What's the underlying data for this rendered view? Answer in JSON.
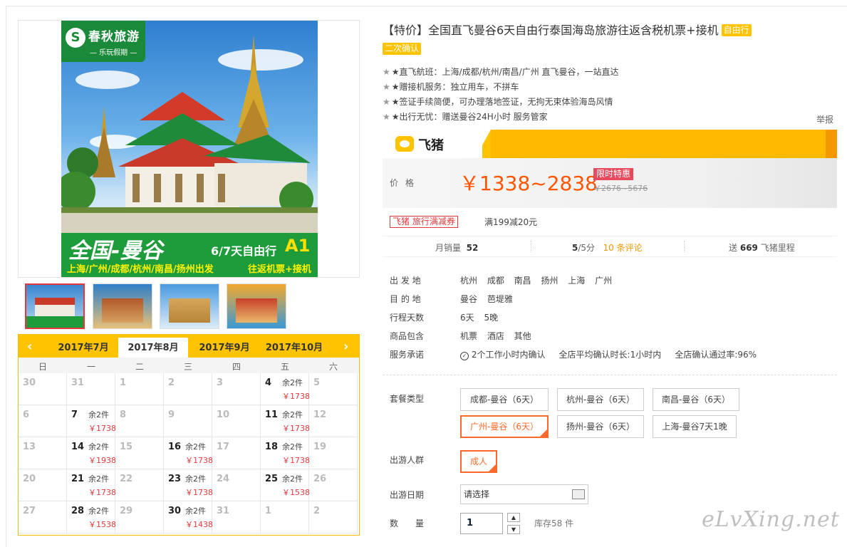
{
  "product": {
    "title": "【特价】全国直飞曼谷6天自由行泰国海岛旅游往返含税机票+接机",
    "tag_free": "自由行",
    "tag_confirm": "二次确认",
    "features": [
      "★直飞航班：上海/成都/杭州/南昌/广州 直飞曼谷，一站直达",
      "★赠接机服务：独立用车，不拼车",
      "★签证手续简便，可办理落地签证，无拘无束体验海岛风情",
      "★出行无忧：赠送曼谷24H小时 服务管家"
    ],
    "report": "举报",
    "brand": "飞猪",
    "price_label": "价格",
    "price": "￥1338~2838",
    "promo": "限时特惠",
    "price_old": "￥2676~5676",
    "coupon_badge": "飞猪 旅行满减券",
    "coupon_text": "满199减20元",
    "stats": {
      "monthly_label": "月销量",
      "monthly_value": "52",
      "rating_value": "5",
      "rating_suffix": "/5分",
      "reviews": "10 条评论",
      "miles_prefix": "送",
      "miles_value": "669",
      "miles_suffix": "飞猪里程"
    },
    "info": [
      {
        "label": "出 发 地",
        "value": "杭州  成都  南昌  扬州  上海  广州"
      },
      {
        "label": "目 的 地",
        "value": "曼谷  芭堤雅"
      },
      {
        "label": "行程天数",
        "value": "6天  5晚"
      },
      {
        "label": "商品包含",
        "value": "机票  酒店  其他"
      }
    ],
    "service_label": "服务承诺",
    "service_items": [
      "2个工作小时内确认",
      "全店平均确认时长:1小时内",
      "全店确认通过率:96%"
    ],
    "package_label": "套餐类型",
    "packages": [
      "成都-曼谷（6天）",
      "杭州-曼谷（6天）",
      "南昌-曼谷（6天）",
      "广州-曼谷（6天）",
      "扬州-曼谷（6天）",
      "上海-曼谷7天1晚"
    ],
    "crowd_label": "出游人群",
    "crowd_option": "成人",
    "date_label": "出游日期",
    "date_placeholder": "请选择",
    "qty_label": "数　　量",
    "qty_value": "1",
    "stock": "库存58 件",
    "watermark": "eLvXing.net"
  },
  "hero": {
    "logo_name": "春秋旅游",
    "logo_sub": "— 乐玩假期 —",
    "banner_title": "全国-曼谷",
    "banner_days": "6/7天自由行",
    "banner_code": "A1",
    "banner_cities": "上海/广州/成都/杭州/南昌/扬州出发",
    "banner_ticket": "往返机票+接机"
  },
  "calendar": {
    "months": [
      "2017年7月",
      "2017年8月",
      "2017年9月",
      "2017年10月"
    ],
    "active_month": 1,
    "weekdays": [
      "日",
      "一",
      "二",
      "三",
      "四",
      "五",
      "六"
    ],
    "weeks": [
      [
        {
          "d": "30"
        },
        {
          "d": "31"
        },
        {
          "d": "1"
        },
        {
          "d": "2"
        },
        {
          "d": "3"
        },
        {
          "d": "4",
          "s": "余2件",
          "p": "￥1738"
        },
        {
          "d": "5"
        }
      ],
      [
        {
          "d": "6"
        },
        {
          "d": "7",
          "s": "余2件",
          "p": "￥1738"
        },
        {
          "d": "8"
        },
        {
          "d": "9"
        },
        {
          "d": "10"
        },
        {
          "d": "11",
          "s": "余2件",
          "p": "￥1738"
        },
        {
          "d": "12"
        }
      ],
      [
        {
          "d": "13"
        },
        {
          "d": "14",
          "s": "余2件",
          "p": "￥1938"
        },
        {
          "d": "15"
        },
        {
          "d": "16",
          "s": "余2件",
          "p": "￥1738"
        },
        {
          "d": "17"
        },
        {
          "d": "18",
          "s": "余2件",
          "p": "￥1738"
        },
        {
          "d": "19"
        }
      ],
      [
        {
          "d": "20"
        },
        {
          "d": "21",
          "s": "余2件",
          "p": "￥1738"
        },
        {
          "d": "22"
        },
        {
          "d": "23",
          "s": "余2件",
          "p": "￥1738"
        },
        {
          "d": "24"
        },
        {
          "d": "25",
          "s": "余2件",
          "p": "￥1538"
        },
        {
          "d": "26"
        }
      ],
      [
        {
          "d": "27"
        },
        {
          "d": "28",
          "s": "余2件",
          "p": "￥1538"
        },
        {
          "d": "29"
        },
        {
          "d": "30",
          "s": "余2件",
          "p": "￥1438"
        },
        {
          "d": "31"
        },
        {
          "d": "1"
        },
        {
          "d": "2"
        }
      ]
    ]
  },
  "colors": {
    "accent": "#ffc300",
    "price": "#ff5500",
    "selected": "#ff6a2a",
    "brand_green": "#1e9b3a"
  }
}
